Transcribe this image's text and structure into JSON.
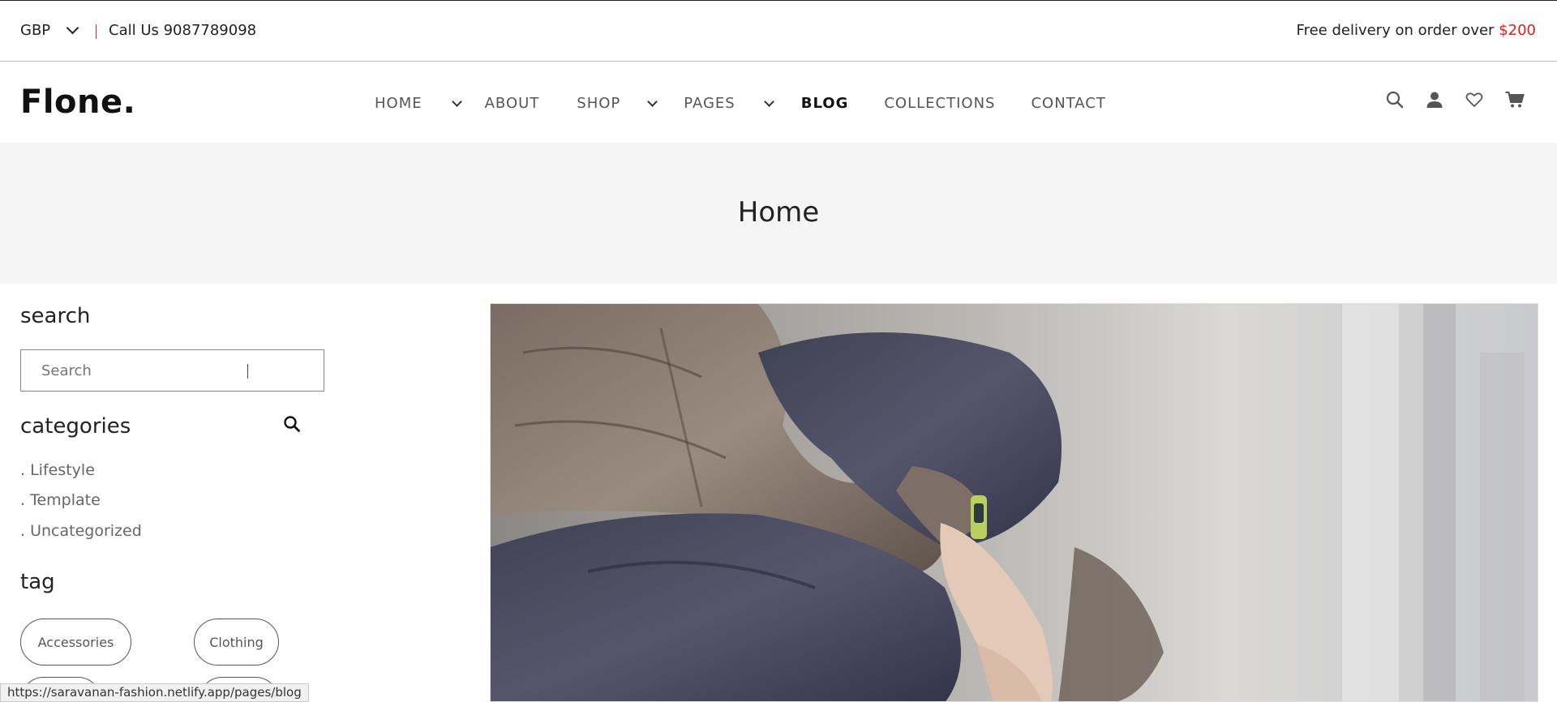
{
  "topbar": {
    "currency": "GBP",
    "call_us": "Call Us 9087789098",
    "promo_text": "Free delivery on order over ",
    "promo_price": "$200",
    "promo_price_color": "#e21b1b"
  },
  "header": {
    "logo": "Flone.",
    "nav": [
      {
        "label": "HOME",
        "has_dropdown": true
      },
      {
        "label": "ABOUT",
        "has_dropdown": false
      },
      {
        "label": "SHOP",
        "has_dropdown": true
      },
      {
        "label": "PAGES",
        "has_dropdown": true
      },
      {
        "label": "BLOG",
        "has_dropdown": false,
        "active": true
      },
      {
        "label": "COLLECTIONS",
        "has_dropdown": false
      },
      {
        "label": "CONTACT",
        "has_dropdown": false
      }
    ],
    "icons": [
      "search-icon",
      "user-icon",
      "heart-icon",
      "cart-icon"
    ]
  },
  "banner": {
    "title": "Home"
  },
  "sidebar": {
    "search_heading": "search",
    "search_placeholder": "Search",
    "categories_heading": "categories",
    "categories": [
      ". Lifestyle",
      ". Template",
      ". Uncategorized"
    ],
    "tag_heading": "tag",
    "tags": [
      "Accessories",
      "Clothing"
    ]
  },
  "status_url": "https://saravanan-fashion.netlify.app/pages/blog"
}
